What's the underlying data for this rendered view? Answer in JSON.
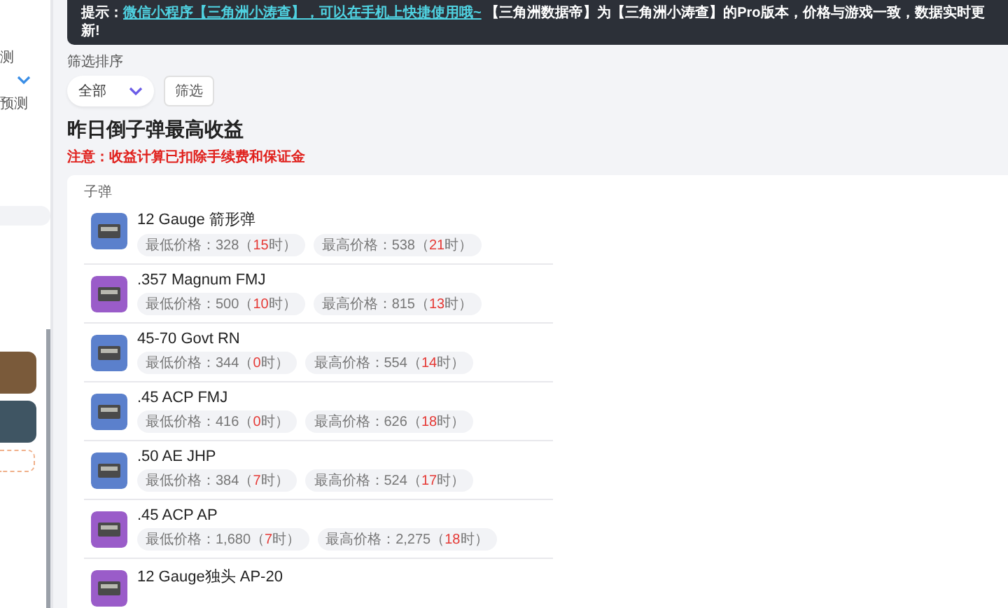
{
  "sidebar": {
    "items": [
      {
        "kind": "text",
        "label": "测"
      },
      {
        "kind": "chevron"
      },
      {
        "kind": "text",
        "label": "预测"
      }
    ]
  },
  "banner": {
    "prefix": "提示：",
    "link": "微信小程序【三角洲小涛查】，可以在手机上快捷使用哦~",
    "text": "【三角洲数据帝】为【三角洲小涛查】的Pro版本，价格与游戏一致，数据实时更新!"
  },
  "filter": {
    "label": "筛选排序",
    "select_value": "全部",
    "button": "筛选"
  },
  "title": "昨日倒子弹最高收益",
  "note": "注意：收益计算已扣除手续费和保证金",
  "card": {
    "heading": "子弹",
    "items": [
      {
        "name": "12 Gauge 箭形弹",
        "color": "#5b80cc",
        "prices": [
          {
            "prefix": "最低价格：328（",
            "hour": "15",
            "suffix": "时）"
          },
          {
            "prefix": "最高价格：538（",
            "hour": "21",
            "suffix": "时）"
          }
        ]
      },
      {
        "name": ".357 Magnum FMJ",
        "color": "#9a5cc9",
        "prices": [
          {
            "prefix": "最低价格：500（",
            "hour": "10",
            "suffix": "时）"
          },
          {
            "prefix": "最高价格：815（",
            "hour": "13",
            "suffix": "时）"
          }
        ]
      },
      {
        "name": "45-70 Govt RN",
        "color": "#5b80cc",
        "prices": [
          {
            "prefix": "最低价格：344（",
            "hour": "0",
            "suffix": "时）"
          },
          {
            "prefix": "最高价格：554（",
            "hour": "14",
            "suffix": "时）"
          }
        ]
      },
      {
        "name": ".45 ACP FMJ",
        "color": "#5b80cc",
        "prices": [
          {
            "prefix": "最低价格：416（",
            "hour": "0",
            "suffix": "时）"
          },
          {
            "prefix": "最高价格：626（",
            "hour": "18",
            "suffix": "时）"
          }
        ]
      },
      {
        "name": ".50 AE JHP",
        "color": "#5b80cc",
        "prices": [
          {
            "prefix": "最低价格：384（",
            "hour": "7",
            "suffix": "时）"
          },
          {
            "prefix": "最高价格：524（",
            "hour": "17",
            "suffix": "时）"
          }
        ]
      },
      {
        "name": ".45 ACP AP",
        "color": "#9a5cc9",
        "prices": [
          {
            "prefix": "最低价格：1,680（",
            "hour": "7",
            "suffix": "时）"
          },
          {
            "prefix": "最高价格：2,275（",
            "hour": "18",
            "suffix": "时）"
          }
        ]
      },
      {
        "name": "12 Gauge独头 AP-20",
        "color": "#9a5cc9"
      }
    ]
  }
}
